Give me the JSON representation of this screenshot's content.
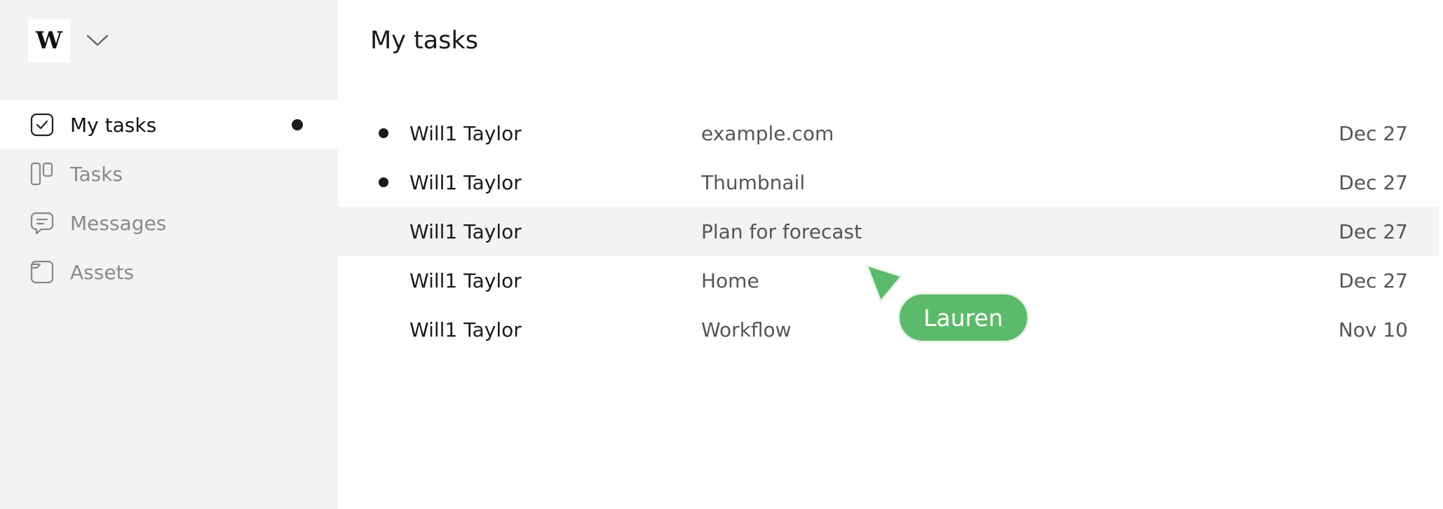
{
  "workspace": {
    "logo_letter": "W",
    "chevron_icon": "chevron-down-icon"
  },
  "sidebar": {
    "items": [
      {
        "label": "My tasks",
        "icon": "check-square-icon",
        "active": true,
        "has_unread_dot": true
      },
      {
        "label": "Tasks",
        "icon": "board-columns-icon",
        "active": false,
        "has_unread_dot": false
      },
      {
        "label": "Messages",
        "icon": "chat-bubble-icon",
        "active": false,
        "has_unread_dot": false
      },
      {
        "label": "Assets",
        "icon": "folder-icon",
        "active": false,
        "has_unread_dot": false
      }
    ]
  },
  "main": {
    "title": "My tasks",
    "tasks": [
      {
        "assignee": "Will1 Taylor",
        "title": "example.com",
        "date": "Dec 27",
        "unread": true
      },
      {
        "assignee": "Will1 Taylor",
        "title": "Thumbnail",
        "date": "Dec 27",
        "unread": true
      },
      {
        "assignee": "Will1 Taylor",
        "title": "Plan for forecast",
        "date": "Dec 27",
        "unread": false
      },
      {
        "assignee": "Will1 Taylor",
        "title": "Home",
        "date": "Dec 27",
        "unread": false
      },
      {
        "assignee": "Will1 Taylor",
        "title": "Workflow",
        "date": "Nov 10",
        "unread": false
      }
    ]
  },
  "collaborator_cursor": {
    "name": "Lauren",
    "color": "#5cbb6b"
  },
  "colors": {
    "sidebar_bg": "#f3f3f3",
    "active_bg": "#ffffff",
    "row_highlight": "#f3f3f4",
    "cursor_green": "#5cbb6b"
  }
}
